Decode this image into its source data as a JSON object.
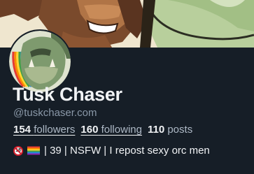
{
  "profile": {
    "display_name": "Tusk Chaser",
    "handle": "@tuskchaser.com",
    "followers_count": "154",
    "followers_label": "followers",
    "following_count": "160",
    "following_label": "following",
    "posts_count": "110",
    "posts_label": "posts",
    "bio_text": "| 39 | NSFW | I repost sexy orc men",
    "bio_icons": [
      "18-plus-icon",
      "rainbow-flag-icon"
    ]
  },
  "colors": {
    "background": "#161e27",
    "text": "#f1f3f5",
    "muted": "#8a98a8"
  }
}
